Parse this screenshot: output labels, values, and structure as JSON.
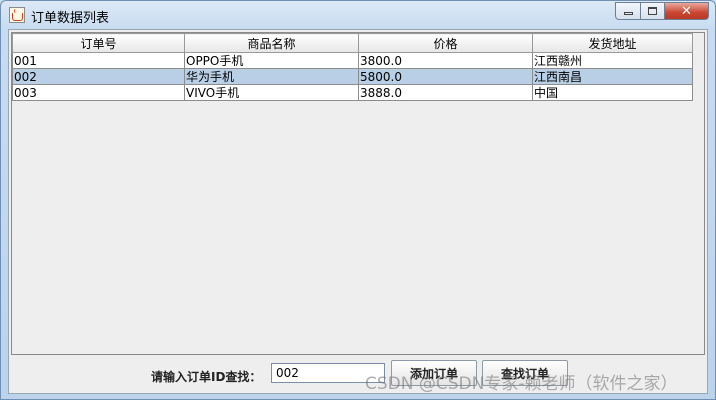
{
  "window": {
    "title": "订单数据列表",
    "controls": {
      "minimize": "",
      "maximize": "",
      "close": "✕"
    }
  },
  "table": {
    "columns": [
      "订单号",
      "商品名称",
      "价格",
      "发货地址"
    ],
    "rows": [
      [
        "001",
        "OPPO手机",
        "3800.0",
        "江西赣州"
      ],
      [
        "002",
        "华为手机",
        "5800.0",
        "江西南昌"
      ],
      [
        "003",
        "VIVO手机",
        "3888.0",
        "中国"
      ]
    ],
    "selected_row": 1
  },
  "search": {
    "label": "请输入订单ID查找：",
    "value": "002"
  },
  "buttons": {
    "add": "添加订单",
    "find": "查找订单"
  },
  "watermark": "CSDN @CSDN专家-赖老师（软件之家）",
  "colors": {
    "selection": "#b8cfe5",
    "close_button": "#c94532"
  }
}
